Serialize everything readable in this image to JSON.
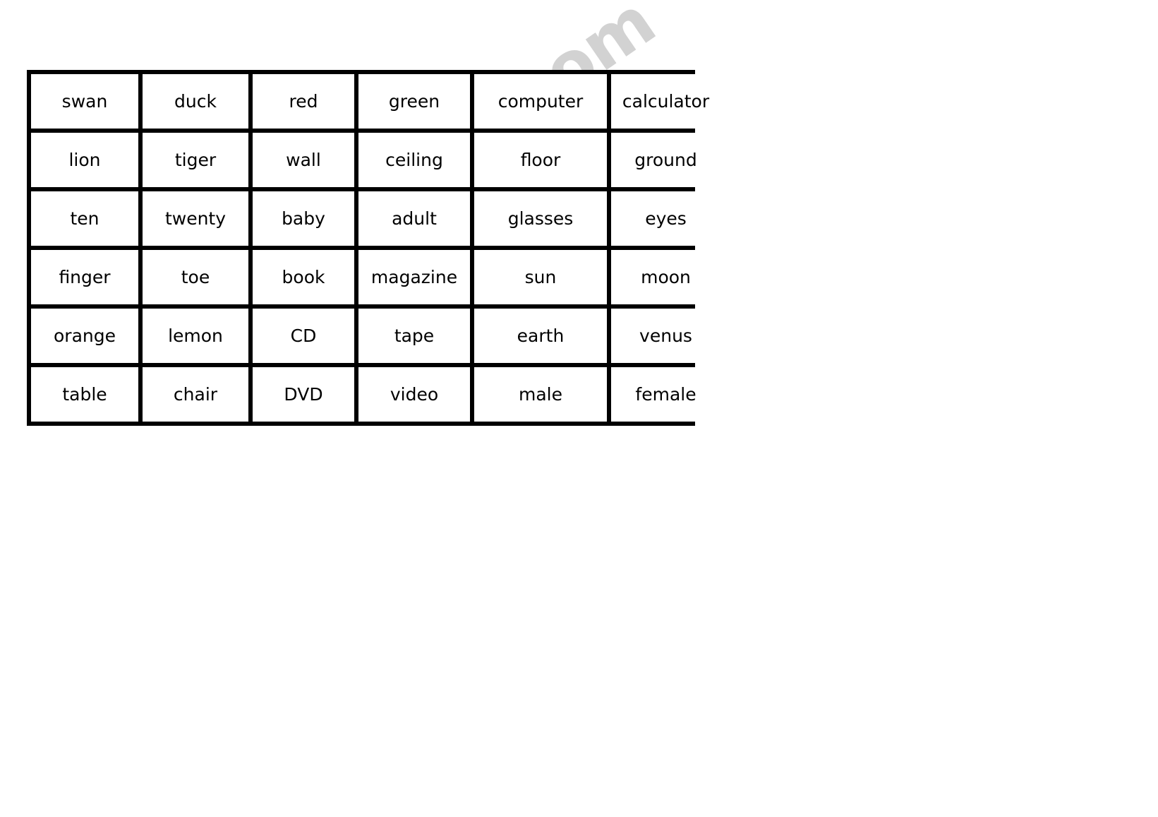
{
  "document": {
    "type": "worksheet",
    "background_color": "#ffffff",
    "watermark": {
      "text": "ESLprintables.com",
      "color": "#d2d2d2",
      "rotation_deg": -34.5
    }
  },
  "word_grid": {
    "columns": 6,
    "rows": 6,
    "border_color": "#000000",
    "cell_background": "#ffffff",
    "text_color": "#000000",
    "cells": [
      [
        "swan",
        "duck",
        "red",
        "green",
        "computer",
        "calculator"
      ],
      [
        "lion",
        "tiger",
        "wall",
        "ceiling",
        "floor",
        "ground"
      ],
      [
        "ten",
        "twenty",
        "baby",
        "adult",
        "glasses",
        "eyes"
      ],
      [
        "finger",
        "toe",
        "book",
        "magazine",
        "sun",
        "moon"
      ],
      [
        "orange",
        "lemon",
        "CD",
        "tape",
        "earth",
        "venus"
      ],
      [
        "table",
        "chair",
        "DVD",
        "video",
        "male",
        "female"
      ]
    ]
  }
}
